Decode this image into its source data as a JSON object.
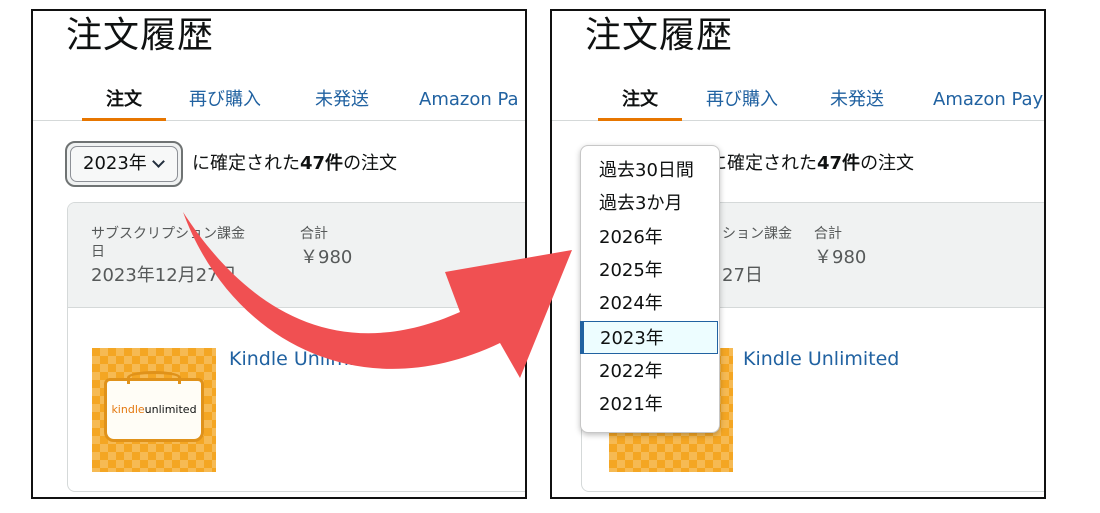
{
  "colors": {
    "accent": "#e77600",
    "link": "#2162a1",
    "arrow": "#f05052",
    "header_bg": "#f0f2f2"
  },
  "left": {
    "title": "注文履歴",
    "tabs": [
      "注文",
      "再び購入",
      "未発送",
      "Amazon Pa"
    ],
    "year_select": "2023年",
    "filter": {
      "prefix": "に確定された",
      "count": "47件",
      "suffix": "の注文"
    },
    "order": {
      "type_label_line1": "サブスクリプション課金",
      "type_label_line2": "日",
      "date": "2023年12月27日",
      "total_label": "合計",
      "total_value": "￥980",
      "product_name": "Kindle Unlimited",
      "logo_kindle": "kindle",
      "logo_unlimited": "unlimited"
    }
  },
  "right": {
    "title": "注文履歴",
    "tabs": [
      "注文",
      "再び購入",
      "未発送",
      "Amazon Pay"
    ],
    "filter": {
      "prefix": "に確定された",
      "count": "47件",
      "suffix": "の注文"
    },
    "order": {
      "type_label": "ション課金",
      "date": "27日",
      "total_label": "合計",
      "total_value": "￥980",
      "product_name": "Kindle Unlimited"
    },
    "dropdown": {
      "options": [
        "過去30日間",
        "過去3か月",
        "2026年",
        "2025年",
        "2024年",
        "2023年",
        "2022年",
        "2021年"
      ],
      "selected": "2023年"
    }
  },
  "arrow_icon": "curved-arrow-icon"
}
